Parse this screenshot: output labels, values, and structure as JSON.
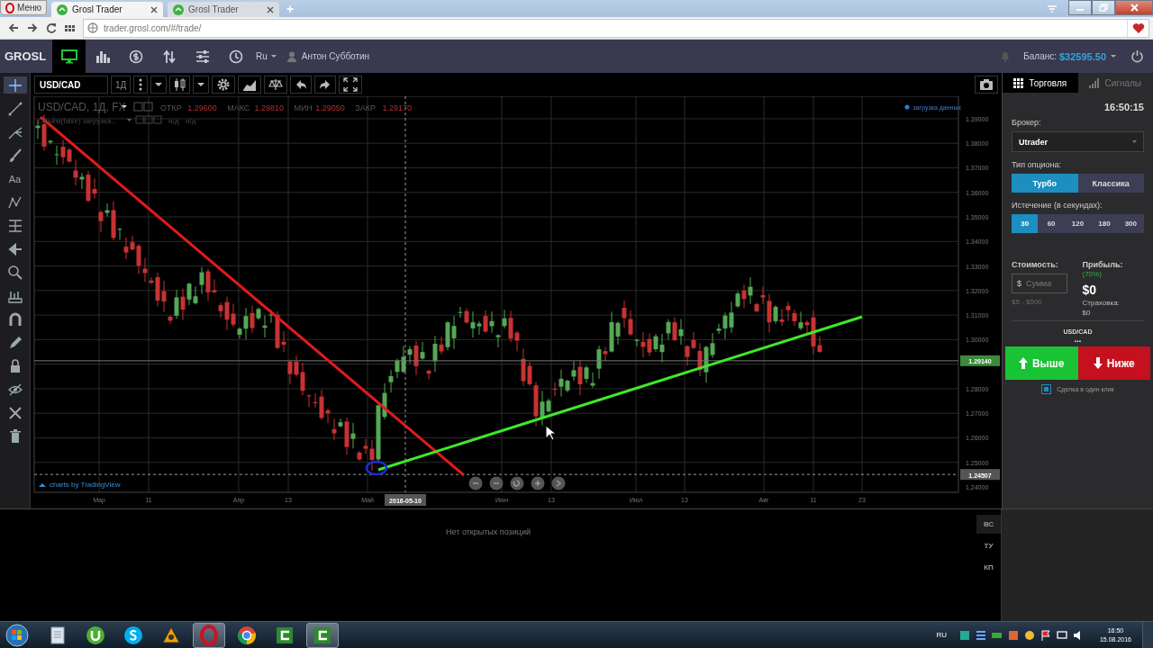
{
  "browser": {
    "menu_button": "Меню",
    "tabs": [
      {
        "title": "Grosl Trader",
        "selected": true
      },
      {
        "title": "Grosl Trader",
        "selected": false
      }
    ],
    "new_tab": "+",
    "url": "trader.grosl.com/#/trade/"
  },
  "app_header": {
    "logo": "GROSL",
    "nav": [
      {
        "kind": "monitor",
        "selected": true
      },
      {
        "kind": "bars",
        "selected": false
      },
      {
        "kind": "dollar",
        "selected": false
      },
      {
        "kind": "updown",
        "selected": false
      },
      {
        "kind": "sliders",
        "selected": false
      },
      {
        "kind": "clock",
        "selected": false
      }
    ],
    "language": "Ru",
    "user": "Антон Субботин",
    "balance_label": "Баланс:",
    "balance": "$32595.50"
  },
  "drawing_tools": [
    {
      "kind": "crosshair",
      "selected": true
    },
    {
      "kind": "line",
      "selected": false
    },
    {
      "kind": "pitchfork",
      "selected": false
    },
    {
      "kind": "brush",
      "selected": false
    },
    {
      "kind": "text",
      "label": "Aa",
      "selected": false
    },
    {
      "kind": "zigzag",
      "selected": false
    },
    {
      "kind": "fib",
      "selected": false
    },
    {
      "kind": "arrow",
      "selected": false
    },
    {
      "kind": "zoom",
      "selected": false
    },
    {
      "kind": "ruler",
      "selected": false
    },
    {
      "kind": "magnet",
      "selected": false
    },
    {
      "kind": "pencil",
      "selected": false
    },
    {
      "kind": "lock",
      "selected": false
    },
    {
      "kind": "eye",
      "selected": false
    },
    {
      "kind": "tools",
      "selected": false
    },
    {
      "kind": "trash",
      "selected": false
    }
  ],
  "chart_toolbar": {
    "symbol": "USD/CAD",
    "interval": "1Д"
  },
  "chart": {
    "legend_title": "USD/CAD, 1Д, FX",
    "ohlc": [
      {
        "label": "ОТКР",
        "value": "1.29600"
      },
      {
        "label": "МАКС",
        "value": "1.29810"
      },
      {
        "label": "МИН",
        "value": "1.29050"
      },
      {
        "label": "ЗАКР",
        "value": "1.29170"
      }
    ],
    "volume_legend": "Объём(false) загрузка...",
    "volume_values": [
      "н/д",
      "н/д"
    ],
    "loading": "загрузка данных",
    "price_labels": [
      "1.39000",
      "1.38000",
      "1.37000",
      "1.36000",
      "1.35000",
      "1.34000",
      "1.33000",
      "1.32000",
      "1.31000",
      "1.30000",
      "1.28000",
      "1.27000",
      "1.26000",
      "1.25000",
      "1.24000"
    ],
    "price_tags": [
      {
        "kind": "last",
        "value": "1.29140"
      },
      {
        "kind": "crosshair",
        "value": "1.24507"
      }
    ],
    "time_labels": [
      "Мар",
      "11",
      "Апр",
      "13",
      "Май",
      "Июн",
      "13",
      "Июл",
      "13",
      "Авг",
      "11",
      "23"
    ],
    "crosshair_date": "2016-05-10",
    "credit": "charts by TradingView"
  },
  "positions": {
    "empty_message": "Нет открытых позиций",
    "tabs": [
      {
        "label": "ВС",
        "selected": true
      },
      {
        "label": "ТУ",
        "selected": false
      },
      {
        "label": "КП",
        "selected": false
      }
    ]
  },
  "trade_panel": {
    "tabs": [
      {
        "kind": "grid",
        "label": "Торговля",
        "selected": true
      },
      {
        "kind": "signal",
        "label": "Сигналы",
        "selected": false
      }
    ],
    "time": "16:50:15",
    "broker_label": "Брокер:",
    "broker": "Utrader",
    "option_type_label": "Тип опциона:",
    "option_types": [
      {
        "label": "Турбо",
        "selected": true
      },
      {
        "label": "Классика",
        "selected": false
      }
    ],
    "expiry_label": "Истечение (в секундах):",
    "expiries": [
      {
        "label": "30",
        "selected": true
      },
      {
        "label": "60",
        "selected": false
      },
      {
        "label": "120",
        "selected": false
      },
      {
        "label": "180",
        "selected": false
      },
      {
        "label": "300",
        "selected": false
      }
    ],
    "cost_label": "Стоимость:",
    "amount_prefix": "$",
    "amount_placeholder": "Сумма",
    "amount_hint": "$5 - $500",
    "profit_label": "Прибыль:",
    "profit_percent": "(70%)",
    "profit": "$0",
    "insurance_label": "Страховка:",
    "insurance": "$0",
    "asset": "USD/CAD",
    "price": "...",
    "call_button": "Выше",
    "put_button": "Ниже",
    "one_click": {
      "label": "Сделка в один клик",
      "checked": true
    }
  },
  "taskbar": {
    "apps": [
      {
        "kind": "notepad",
        "active": false
      },
      {
        "kind": "torrent",
        "active": false
      },
      {
        "kind": "skype",
        "active": false
      },
      {
        "kind": "player",
        "active": false
      },
      {
        "kind": "opera",
        "active": true
      },
      {
        "kind": "chrome",
        "active": false
      },
      {
        "kind": "recorder",
        "active": false
      },
      {
        "kind": "recorder",
        "active": true
      }
    ],
    "language": "RU",
    "time": "16:50",
    "date": "15.08.2016"
  }
}
